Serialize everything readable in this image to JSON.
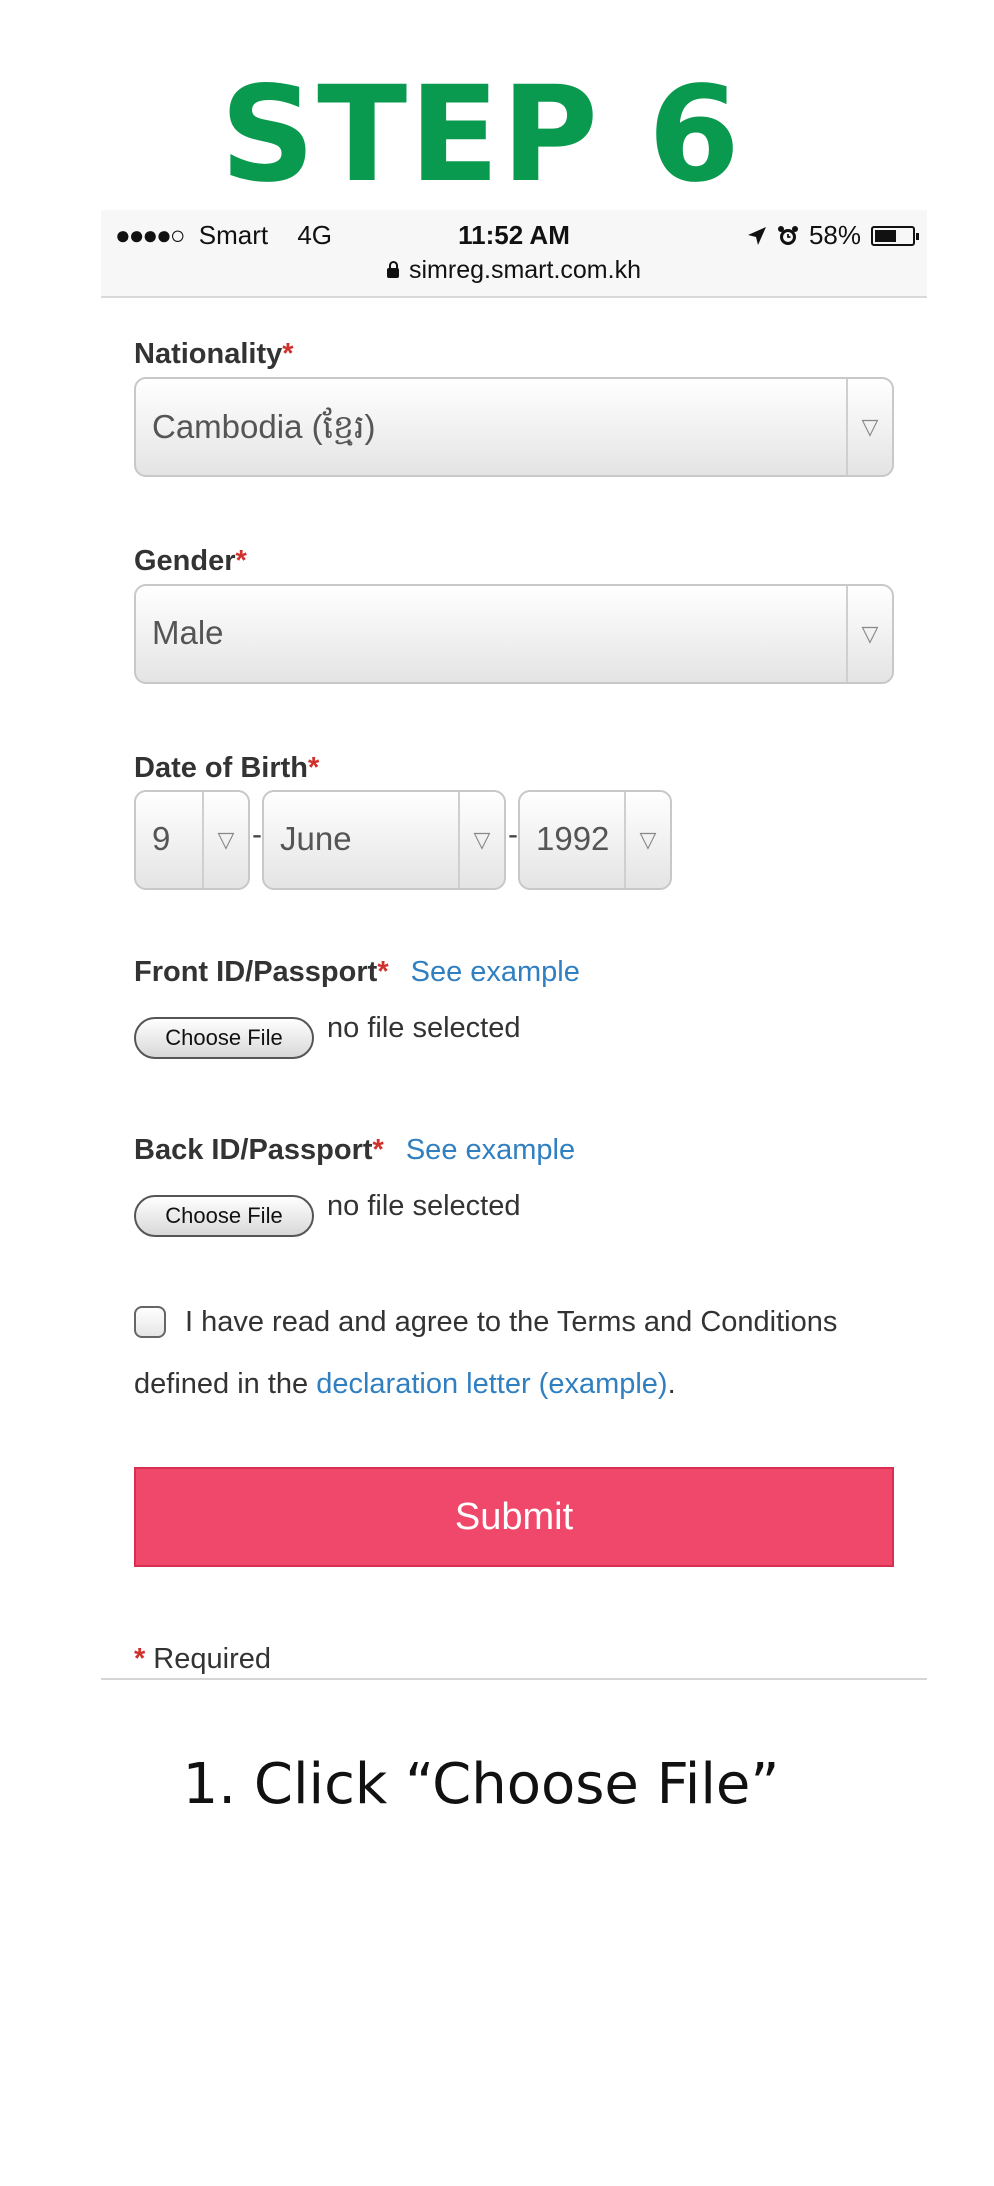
{
  "header": {
    "title": "STEP 6"
  },
  "status_bar": {
    "signal": "●●●●○",
    "carrier": "Smart",
    "network": "4G",
    "time": "11:52 AM",
    "battery": "58%",
    "url": "simreg.smart.com.kh",
    "battery_level": 0.58
  },
  "form": {
    "required_marker": "*",
    "nationality": {
      "label": "Nationality",
      "value": "Cambodia (ខ្មែរ)"
    },
    "gender": {
      "label": "Gender",
      "value": "Male"
    },
    "dob": {
      "label": "Date of Birth",
      "day": "9",
      "month": "June",
      "year": "1992",
      "separator": "-"
    },
    "front_id": {
      "label": "Front ID/Passport",
      "example_link": "See example",
      "button": "Choose File",
      "status": "no file selected"
    },
    "back_id": {
      "label": "Back ID/Passport",
      "example_link": "See example",
      "button": "Choose File",
      "status": "no file selected"
    },
    "terms": {
      "line1": "I have read and agree to the Terms and Conditions",
      "line2_prefix": "defined in the ",
      "link": "declaration letter (example)",
      "line2_suffix": "."
    },
    "submit_label": "Submit",
    "required_note": "Required"
  },
  "instruction": "1. Click “Choose File”",
  "colors": {
    "step_green": "#0a9a4f",
    "submit": "#f0486a",
    "link": "#2f7fc1",
    "required": "#d0312d"
  },
  "icons": {
    "arrow": "▽",
    "location": "location-arrow-icon",
    "alarm": "alarm-icon",
    "lock": "lock-icon"
  }
}
